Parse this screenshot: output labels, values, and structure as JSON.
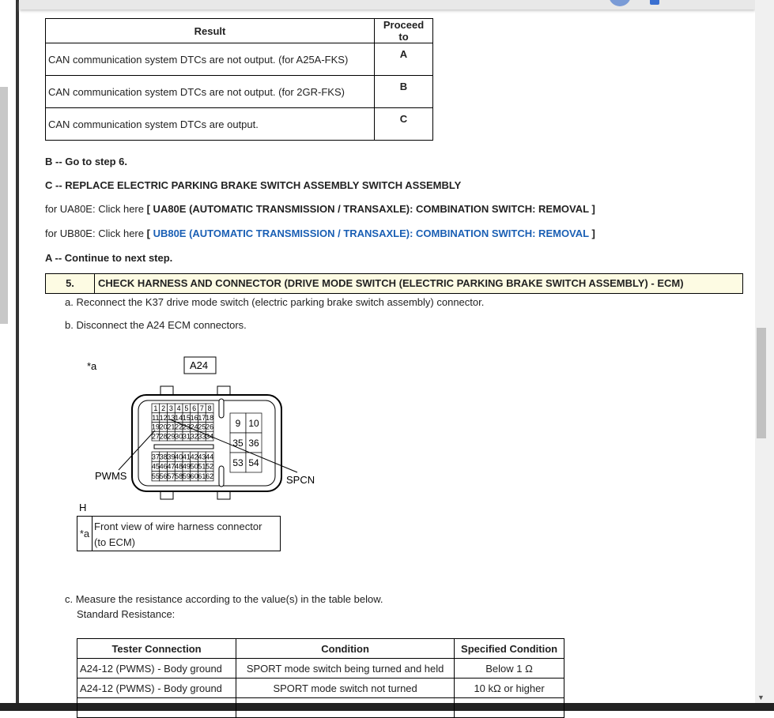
{
  "result_table": {
    "headers": [
      "Result",
      "Proceed to"
    ],
    "rows": [
      [
        "CAN communication system DTCs are not output. (for A25A-FKS)",
        "A"
      ],
      [
        "CAN communication system DTCs are not output. (for 2GR-FKS)",
        "B"
      ],
      [
        "CAN communication system DTCs are output.",
        "C"
      ]
    ]
  },
  "lines": {
    "b": "B -- Go to step 6.",
    "c": "C -- REPLACE ELECTRIC PARKING BRAKE SWITCH ASSEMBLY SWITCH ASSEMBLY",
    "ua_prefix": "for UA80E: Click here ",
    "ua_link": "[ UA80E (AUTOMATIC TRANSMISSION / TRANSAXLE): COMBINATION SWITCH: REMOVAL ]",
    "ub_prefix": "for UB80E: Click here ",
    "ub_link_open": "[ ",
    "ub_link": "UB80E (AUTOMATIC TRANSMISSION / TRANSAXLE): COMBINATION SWITCH: REMOVAL",
    "ub_link_close": " ]",
    "a": "A -- Continue to next step."
  },
  "step": {
    "number": "5.",
    "title": "CHECK HARNESS AND CONNECTOR (DRIVE MODE SWITCH (ELECTRIC PARKING BRAKE SWITCH ASSEMBLY) - ECM)"
  },
  "substeps": {
    "a": "a. Reconnect the K37 drive mode switch (electric parking brake switch assembly) connector.",
    "b": "b. Disconnect the A24 ECM connectors.",
    "c": "c. Measure the resistance according to the value(s) in the table below.",
    "c2": "Standard Resistance:"
  },
  "diagram": {
    "mark": "*a",
    "connector": "A24",
    "pwms": "PWMS",
    "spcn": "SPCN",
    "h": "H",
    "caption_key": "*a",
    "caption": "Front view of wire harness connector",
    "caption2": "(to ECM)",
    "pins_top": [
      [
        "1",
        "2",
        "3",
        "4",
        "5",
        "6",
        "7",
        "8"
      ],
      [
        "11",
        "12",
        "13",
        "14",
        "15",
        "16",
        "17",
        "18"
      ],
      [
        "19",
        "20",
        "21",
        "22",
        "23",
        "24",
        "25",
        "26"
      ],
      [
        "27",
        "28",
        "29",
        "30",
        "31",
        "32",
        "33",
        "34"
      ]
    ],
    "pins_bottom": [
      [
        "37",
        "38",
        "39",
        "40",
        "41",
        "42",
        "43",
        "44"
      ],
      [
        "45",
        "46",
        "47",
        "48",
        "49",
        "50",
        "51",
        "52"
      ],
      [
        "55",
        "56",
        "57",
        "58",
        "59",
        "60",
        "61",
        "62"
      ]
    ],
    "pins_right": [
      [
        "9",
        "10"
      ],
      [
        "35",
        "36"
      ],
      [
        "53",
        "54"
      ]
    ]
  },
  "resistance_table": {
    "headers": [
      "Tester Connection",
      "Condition",
      "Specified Condition"
    ],
    "rows": [
      [
        "A24-12 (PWMS) - Body ground",
        "SPORT mode switch being turned and held",
        "Below 1 Ω"
      ],
      [
        "A24-12 (PWMS) - Body ground",
        "SPORT mode switch not turned",
        "10 kΩ or higher"
      ]
    ]
  }
}
